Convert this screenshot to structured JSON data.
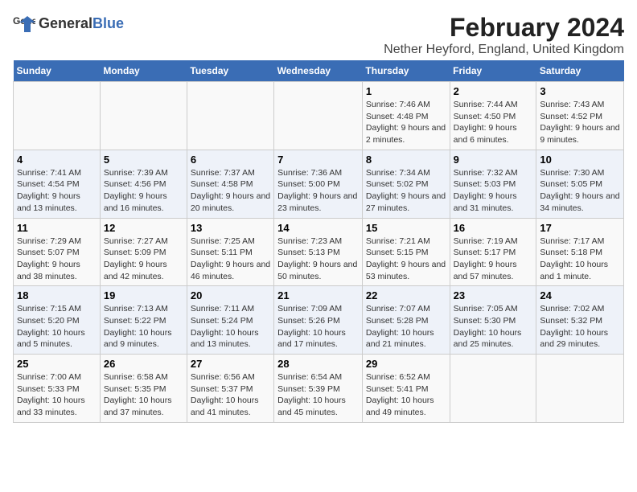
{
  "header": {
    "logo_general": "General",
    "logo_blue": "Blue",
    "title": "February 2024",
    "subtitle": "Nether Heyford, England, United Kingdom"
  },
  "calendar": {
    "columns": [
      "Sunday",
      "Monday",
      "Tuesday",
      "Wednesday",
      "Thursday",
      "Friday",
      "Saturday"
    ],
    "rows": [
      [
        {
          "day": "",
          "info": ""
        },
        {
          "day": "",
          "info": ""
        },
        {
          "day": "",
          "info": ""
        },
        {
          "day": "",
          "info": ""
        },
        {
          "day": "1",
          "info": "Sunrise: 7:46 AM\nSunset: 4:48 PM\nDaylight: 9 hours and 2 minutes."
        },
        {
          "day": "2",
          "info": "Sunrise: 7:44 AM\nSunset: 4:50 PM\nDaylight: 9 hours and 6 minutes."
        },
        {
          "day": "3",
          "info": "Sunrise: 7:43 AM\nSunset: 4:52 PM\nDaylight: 9 hours and 9 minutes."
        }
      ],
      [
        {
          "day": "4",
          "info": "Sunrise: 7:41 AM\nSunset: 4:54 PM\nDaylight: 9 hours and 13 minutes."
        },
        {
          "day": "5",
          "info": "Sunrise: 7:39 AM\nSunset: 4:56 PM\nDaylight: 9 hours and 16 minutes."
        },
        {
          "day": "6",
          "info": "Sunrise: 7:37 AM\nSunset: 4:58 PM\nDaylight: 9 hours and 20 minutes."
        },
        {
          "day": "7",
          "info": "Sunrise: 7:36 AM\nSunset: 5:00 PM\nDaylight: 9 hours and 23 minutes."
        },
        {
          "day": "8",
          "info": "Sunrise: 7:34 AM\nSunset: 5:02 PM\nDaylight: 9 hours and 27 minutes."
        },
        {
          "day": "9",
          "info": "Sunrise: 7:32 AM\nSunset: 5:03 PM\nDaylight: 9 hours and 31 minutes."
        },
        {
          "day": "10",
          "info": "Sunrise: 7:30 AM\nSunset: 5:05 PM\nDaylight: 9 hours and 34 minutes."
        }
      ],
      [
        {
          "day": "11",
          "info": "Sunrise: 7:29 AM\nSunset: 5:07 PM\nDaylight: 9 hours and 38 minutes."
        },
        {
          "day": "12",
          "info": "Sunrise: 7:27 AM\nSunset: 5:09 PM\nDaylight: 9 hours and 42 minutes."
        },
        {
          "day": "13",
          "info": "Sunrise: 7:25 AM\nSunset: 5:11 PM\nDaylight: 9 hours and 46 minutes."
        },
        {
          "day": "14",
          "info": "Sunrise: 7:23 AM\nSunset: 5:13 PM\nDaylight: 9 hours and 50 minutes."
        },
        {
          "day": "15",
          "info": "Sunrise: 7:21 AM\nSunset: 5:15 PM\nDaylight: 9 hours and 53 minutes."
        },
        {
          "day": "16",
          "info": "Sunrise: 7:19 AM\nSunset: 5:17 PM\nDaylight: 9 hours and 57 minutes."
        },
        {
          "day": "17",
          "info": "Sunrise: 7:17 AM\nSunset: 5:18 PM\nDaylight: 10 hours and 1 minute."
        }
      ],
      [
        {
          "day": "18",
          "info": "Sunrise: 7:15 AM\nSunset: 5:20 PM\nDaylight: 10 hours and 5 minutes."
        },
        {
          "day": "19",
          "info": "Sunrise: 7:13 AM\nSunset: 5:22 PM\nDaylight: 10 hours and 9 minutes."
        },
        {
          "day": "20",
          "info": "Sunrise: 7:11 AM\nSunset: 5:24 PM\nDaylight: 10 hours and 13 minutes."
        },
        {
          "day": "21",
          "info": "Sunrise: 7:09 AM\nSunset: 5:26 PM\nDaylight: 10 hours and 17 minutes."
        },
        {
          "day": "22",
          "info": "Sunrise: 7:07 AM\nSunset: 5:28 PM\nDaylight: 10 hours and 21 minutes."
        },
        {
          "day": "23",
          "info": "Sunrise: 7:05 AM\nSunset: 5:30 PM\nDaylight: 10 hours and 25 minutes."
        },
        {
          "day": "24",
          "info": "Sunrise: 7:02 AM\nSunset: 5:32 PM\nDaylight: 10 hours and 29 minutes."
        }
      ],
      [
        {
          "day": "25",
          "info": "Sunrise: 7:00 AM\nSunset: 5:33 PM\nDaylight: 10 hours and 33 minutes."
        },
        {
          "day": "26",
          "info": "Sunrise: 6:58 AM\nSunset: 5:35 PM\nDaylight: 10 hours and 37 minutes."
        },
        {
          "day": "27",
          "info": "Sunrise: 6:56 AM\nSunset: 5:37 PM\nDaylight: 10 hours and 41 minutes."
        },
        {
          "day": "28",
          "info": "Sunrise: 6:54 AM\nSunset: 5:39 PM\nDaylight: 10 hours and 45 minutes."
        },
        {
          "day": "29",
          "info": "Sunrise: 6:52 AM\nSunset: 5:41 PM\nDaylight: 10 hours and 49 minutes."
        },
        {
          "day": "",
          "info": ""
        },
        {
          "day": "",
          "info": ""
        }
      ]
    ]
  }
}
